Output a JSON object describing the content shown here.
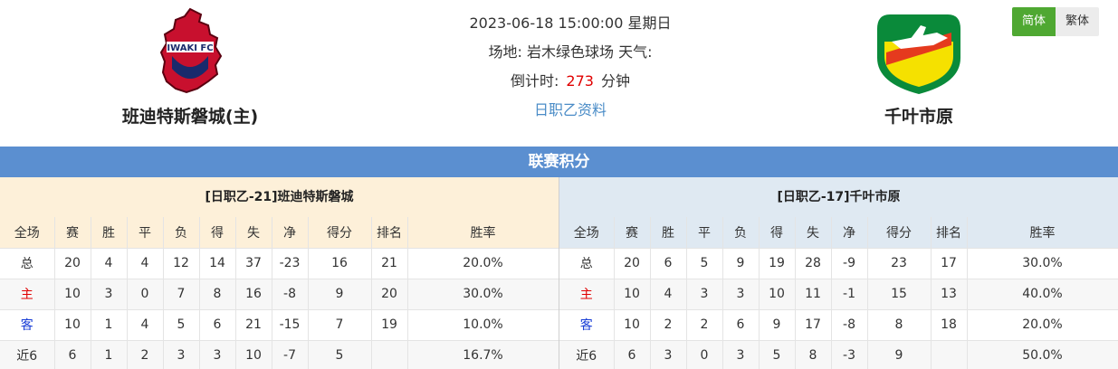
{
  "match": {
    "datetime": "2023-06-18 15:00:00 星期日",
    "venue_line": "场地: 岩木绿色球场 天气:",
    "countdown_label": "倒计时:",
    "countdown_value": "273",
    "countdown_unit": "分钟",
    "league_link": "日职乙资料"
  },
  "home_team": {
    "name": "班迪特斯磐城(主)",
    "logo_text": "IWAKI FC",
    "logo_color": "#c8102e"
  },
  "away_team": {
    "name": "千叶市原",
    "logo_color": "#f5e100"
  },
  "lang": {
    "simplified": "简体",
    "traditional": "繁体"
  },
  "section_title": "联赛积分",
  "columns": [
    "全场",
    "赛",
    "胜",
    "平",
    "负",
    "得",
    "失",
    "净",
    "得分",
    "排名",
    "胜率"
  ],
  "home_standings": {
    "title": "[日职乙-21]班迪特斯磐城",
    "rows": [
      [
        "总",
        "20",
        "4",
        "4",
        "12",
        "14",
        "37",
        "-23",
        "16",
        "21",
        "20.0%"
      ],
      [
        "主",
        "10",
        "3",
        "0",
        "7",
        "8",
        "16",
        "-8",
        "9",
        "20",
        "30.0%"
      ],
      [
        "客",
        "10",
        "1",
        "4",
        "5",
        "6",
        "21",
        "-15",
        "7",
        "19",
        "10.0%"
      ],
      [
        "近6",
        "6",
        "1",
        "2",
        "3",
        "3",
        "10",
        "-7",
        "5",
        "",
        "16.7%"
      ]
    ]
  },
  "away_standings": {
    "title": "[日职乙-17]千叶市原",
    "rows": [
      [
        "总",
        "20",
        "6",
        "5",
        "9",
        "19",
        "28",
        "-9",
        "23",
        "17",
        "30.0%"
      ],
      [
        "主",
        "10",
        "4",
        "3",
        "3",
        "10",
        "11",
        "-1",
        "15",
        "13",
        "40.0%"
      ],
      [
        "客",
        "10",
        "2",
        "2",
        "6",
        "9",
        "17",
        "-8",
        "8",
        "18",
        "20.0%"
      ],
      [
        "近6",
        "6",
        "3",
        "0",
        "3",
        "5",
        "8",
        "-3",
        "9",
        "",
        "50.0%"
      ]
    ]
  }
}
